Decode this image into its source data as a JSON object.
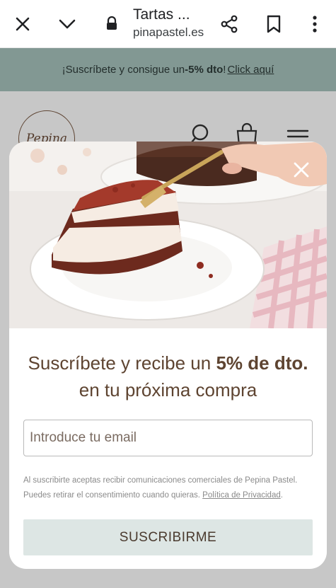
{
  "browser": {
    "title": "Tartas ...",
    "url": "pinapastel.es"
  },
  "site": {
    "promo": {
      "text_before": "¡Suscríbete y consigue un ",
      "discount": "-5% dto",
      "text_after": "! ",
      "link": "Click aquí"
    },
    "logo_text": "Pepina"
  },
  "popup": {
    "headline_before": "Suscríbete y recibe un ",
    "headline_bold": "5% de dto.",
    "headline_after": " en tu próxima compra",
    "email_placeholder": "Introduce tu email",
    "legal_text": "Al suscribirte aceptas recibir comunicaciones comerciales de Pepina Pastel. Puedes retirar el consentimiento cuando quieras. ",
    "privacy_link": "Política de Privacidad",
    "legal_end": ".",
    "subscribe_label": "SUSCRIBIRME"
  },
  "colors": {
    "promo_bg": "#a7c3bd",
    "headline": "#5e4431",
    "button_bg": "#dde6e4"
  }
}
